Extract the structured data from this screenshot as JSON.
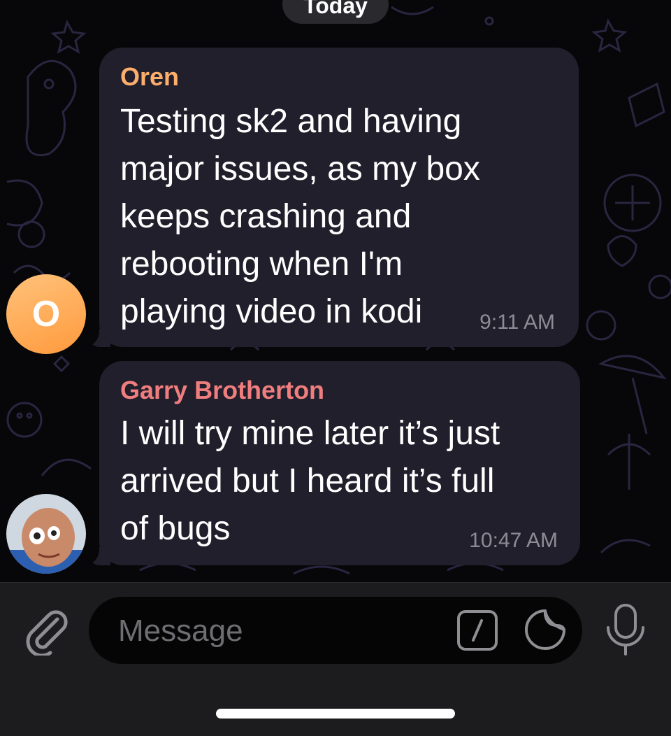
{
  "date_separator": "Today",
  "messages": [
    {
      "sender": "Oren",
      "sender_color": "#fcae6c",
      "avatar_initial": "O",
      "lines": [
        "Testing sk2 and having",
        "major issues, as my box",
        "keeps crashing and",
        "rebooting when I'm",
        "playing video in kodi"
      ],
      "time": "9:11 AM"
    },
    {
      "sender": "Garry Brotherton",
      "sender_color": "#f07e7e",
      "lines": [
        "I will try mine later it’s just",
        "arrived but I heard it’s full",
        "of bugs"
      ],
      "time": "10:47 AM"
    }
  ],
  "composer": {
    "placeholder": "Message",
    "icons": [
      "paperclip-icon",
      "command-slash-icon",
      "sticker-icon",
      "microphone-icon"
    ]
  },
  "colors": {
    "bubble": "#221f2c",
    "accent_oren": "#fcae6c",
    "accent_garry": "#f07e7e",
    "timestamp": "#8d8c95"
  }
}
